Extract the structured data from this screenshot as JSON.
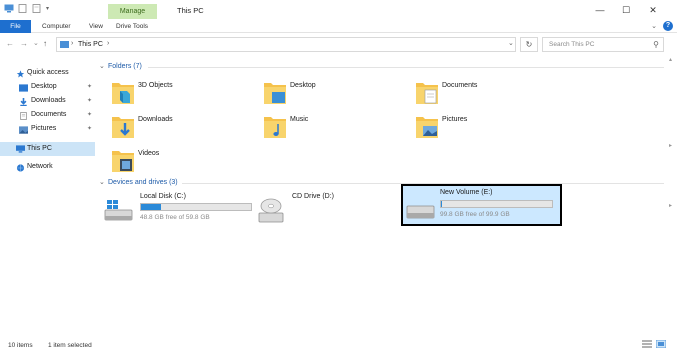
{
  "window": {
    "title": "This PC",
    "context_tab": "Manage",
    "controls": {
      "minimize": "—",
      "maximize": "☐",
      "close": "✕"
    }
  },
  "ribbon": {
    "tabs": [
      "File",
      "Computer",
      "View",
      "Drive Tools"
    ],
    "help": "?"
  },
  "address_bar": {
    "back": "←",
    "forward": "→",
    "recent": "⌄",
    "up": "↑",
    "breadcrumb": [
      "This PC"
    ],
    "separator": "›",
    "refresh": "↻",
    "search_placeholder": "Search This PC"
  },
  "nav_pane": {
    "quick_access": "Quick access",
    "pinned": [
      {
        "label": "Desktop"
      },
      {
        "label": "Downloads"
      },
      {
        "label": "Documents"
      },
      {
        "label": "Pictures"
      }
    ],
    "this_pc": "This PC",
    "network": "Network"
  },
  "folders_group": {
    "header": "Folders (7)",
    "items": [
      "3D Objects",
      "Desktop",
      "Documents",
      "Downloads",
      "Music",
      "Pictures",
      "Videos"
    ]
  },
  "drives_group": {
    "header": "Devices and drives (3)",
    "drives": [
      {
        "name": "Local Disk (C:)",
        "free_text": "48.8 GB free of 59.8 GB",
        "used_fraction": 0.18,
        "has_bar": true,
        "selected": false
      },
      {
        "name": "CD Drive (D:)",
        "free_text": "",
        "used_fraction": 0,
        "has_bar": false,
        "selected": false
      },
      {
        "name": "New Volume (E:)",
        "free_text": "99.8 GB free of 99.9 GB",
        "used_fraction": 0.01,
        "has_bar": true,
        "selected": true
      }
    ]
  },
  "status_bar": {
    "item_count": "10 items",
    "selection": "1 item selected"
  },
  "colors": {
    "accent": "#1e6fcf",
    "selection": "#cce8ff",
    "drive_bar": "#2b8ad8",
    "folder": "#f5c24c",
    "manage_tab": "#cde9b4"
  }
}
